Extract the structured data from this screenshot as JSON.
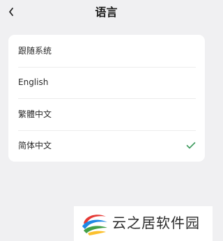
{
  "header": {
    "title": "语言",
    "back_icon": "chevron-left-icon"
  },
  "languages": [
    {
      "label": "跟随系统",
      "selected": false
    },
    {
      "label": "English",
      "selected": false
    },
    {
      "label": "繁體中文",
      "selected": false
    },
    {
      "label": "简体中文",
      "selected": true
    }
  ],
  "check_color": "#3c9a5c",
  "watermark": {
    "text": "云之居软件园",
    "logo_colors": [
      "#e53935",
      "#1e88e5",
      "#43a047",
      "#fbc02d"
    ]
  }
}
